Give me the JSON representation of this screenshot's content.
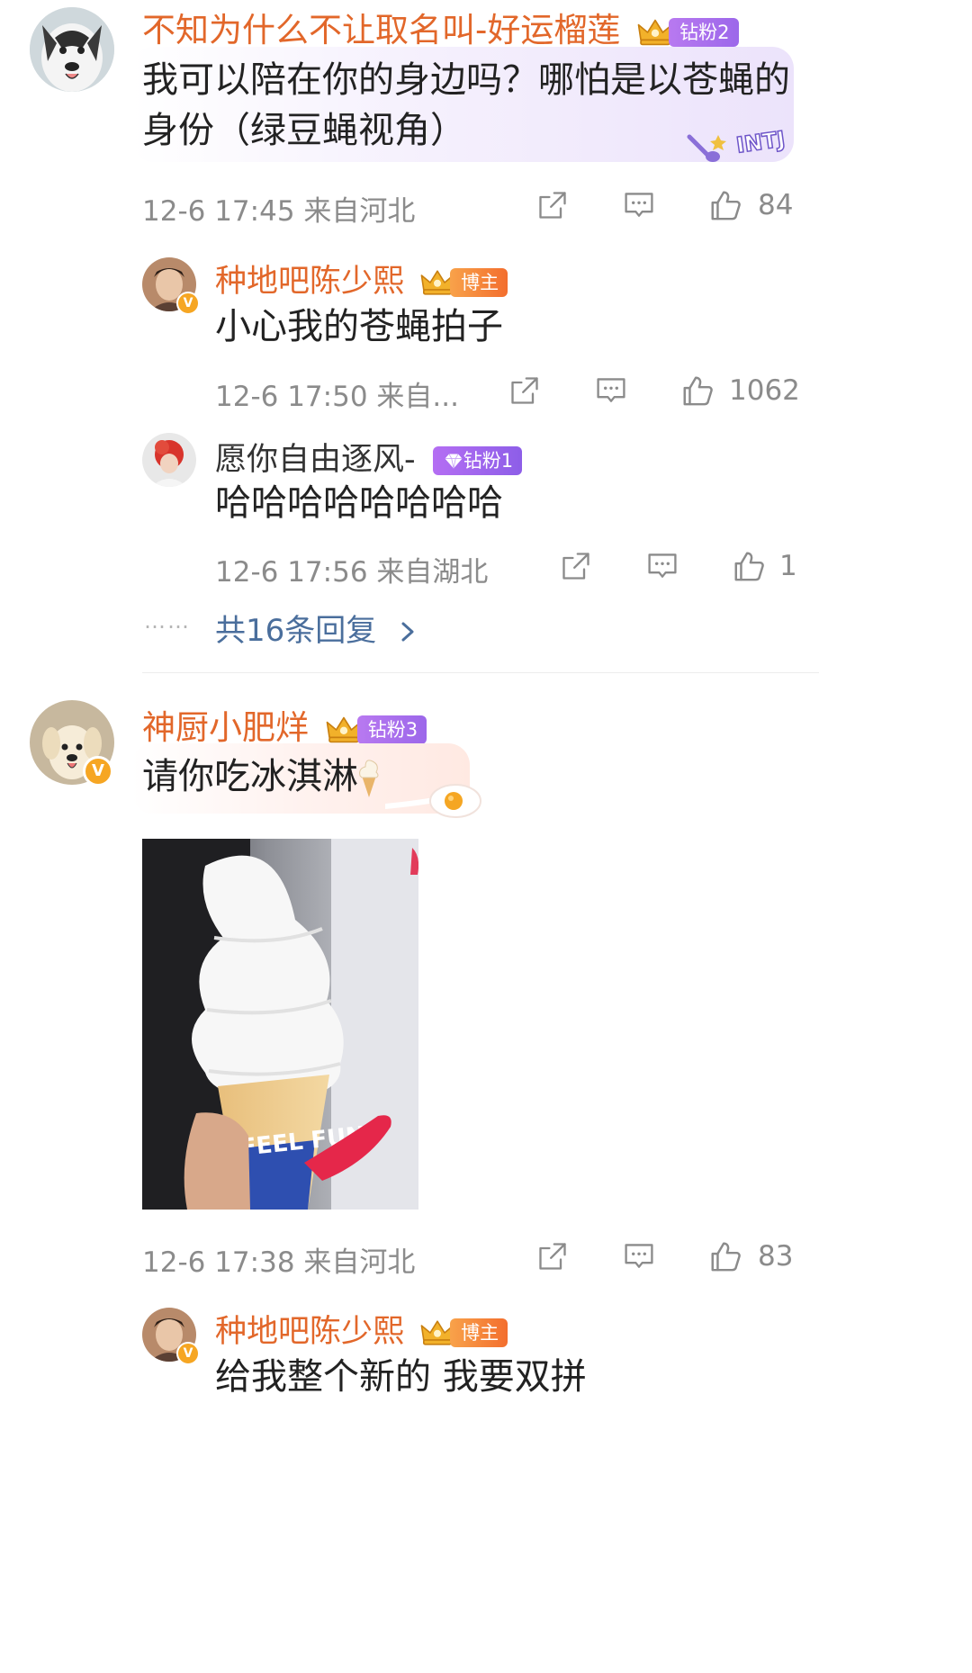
{
  "comments": [
    {
      "user": "不知为什么不让取名叫-好运榴莲",
      "fan_badge": "钻粉2",
      "text_line1": "我可以陪在你的身边吗？哪怕是以苍蝇的",
      "text_line2": "身份（绿豆蝇视角）",
      "sticker_text": "INTJ",
      "meta": "12-6 17:45 来自河北",
      "likes": "84",
      "replies": [
        {
          "user": "种地吧陈少熙",
          "fan_badge": "博主",
          "text": "小心我的苍蝇拍子",
          "meta": "12-6 17:50 来自...",
          "likes": "1062"
        },
        {
          "user": "愿你自由逐风-",
          "fan_badge": "钻粉1",
          "text": "哈哈哈哈哈哈哈哈",
          "meta": "12-6 17:56 来自湖北",
          "likes": "1"
        }
      ],
      "more_replies": "共16条回复",
      "more_dots": "……"
    },
    {
      "user": "神厨小肥烊",
      "fan_badge": "钻粉3",
      "text": "请你吃冰淇淋",
      "photo_text": "FEEL FUN",
      "meta": "12-6 17:38 来自河北",
      "likes": "83",
      "replies": [
        {
          "user": "种地吧陈少熙",
          "fan_badge": "博主",
          "text": "给我整个新的 我要双拼"
        }
      ]
    }
  ],
  "verified_badge": "V",
  "colors": {
    "username": "#e2672a",
    "link": "#4a6e9c",
    "meta": "#8b8b8b",
    "verified": "#f6a623"
  },
  "icons": [
    "share-icon",
    "comment-icon",
    "like-icon",
    "crown-icon",
    "diamond-icon",
    "verified-icon"
  ]
}
